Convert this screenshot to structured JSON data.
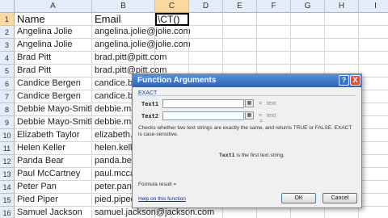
{
  "columns": [
    "A",
    "B",
    "C",
    "D",
    "E",
    "F",
    "G",
    "H",
    "I"
  ],
  "selected_column": "C",
  "rows": [
    {
      "num": "1",
      "a": "Name",
      "b": "Email",
      "c": "\\CT()"
    },
    {
      "num": "2",
      "a": "Angelina Jolie",
      "b": "angelina.jolie@jolie.com",
      "c": ""
    },
    {
      "num": "3",
      "a": "Angelina Jolie",
      "b": "angelina.jolie@jolie.com",
      "c": ""
    },
    {
      "num": "4",
      "a": "Brad Pitt",
      "b": "brad.pitt@pitt.com",
      "c": ""
    },
    {
      "num": "5",
      "a": "Brad Pitt",
      "b": "brad.pitt@pitt.com",
      "c": ""
    },
    {
      "num": "6",
      "a": "Candice Bergen",
      "b": "candice.be",
      "c": ""
    },
    {
      "num": "7",
      "a": "Candice Bergen",
      "b": "candice.be",
      "c": ""
    },
    {
      "num": "8",
      "a": "Debbie Mayo-Smith",
      "b": "debbie.ma",
      "c": ""
    },
    {
      "num": "9",
      "a": "Debbie Mayo-Smith",
      "b": "debbie.ma",
      "c": ""
    },
    {
      "num": "10",
      "a": "Elizabeth Taylor",
      "b": "elizabeth.t",
      "c": ""
    },
    {
      "num": "11",
      "a": "Helen Keller",
      "b": "helen.keller",
      "c": ""
    },
    {
      "num": "12",
      "a": "Panda Bear",
      "b": "panda.bear",
      "c": ""
    },
    {
      "num": "13",
      "a": "Paul McCartney",
      "b": "paul.mccar",
      "c": ""
    },
    {
      "num": "14",
      "a": "Peter Pan",
      "b": "peter.pan@",
      "c": ""
    },
    {
      "num": "15",
      "a": "Pied Piper",
      "b": "pied.piped",
      "c": ""
    },
    {
      "num": "16",
      "a": "Samuel Jackson",
      "b": "samuel.jackson@jackson.com",
      "c": ""
    }
  ],
  "dialog": {
    "title": "Function Arguments",
    "help_glyph": "?",
    "close_glyph": "X",
    "function_name": "EXACT",
    "args": [
      {
        "label": "Text1",
        "value": "",
        "eq": "=",
        "result": "text"
      },
      {
        "label": "Text2",
        "value": "",
        "eq": "=",
        "result": "text"
      }
    ],
    "collapse_glyph": "▦",
    "middle_eq": "=",
    "description": "Checks whether two text strings are exactly the same, and returns TRUE or FALSE. EXACT is case-sensitive.",
    "arg_name": "Text1",
    "arg_description": "is the first text string.",
    "formula_result_label": "Formula result =",
    "help_link": "Help on this function",
    "ok_label": "OK",
    "cancel_label": "Cancel"
  }
}
